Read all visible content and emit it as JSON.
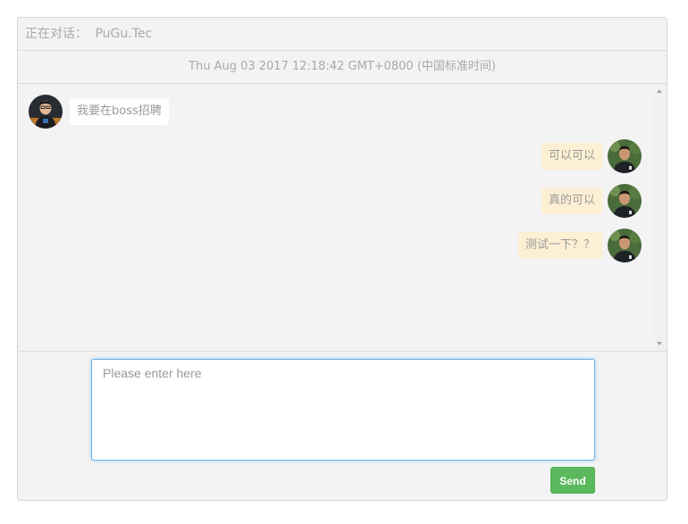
{
  "header": {
    "label": "正在对话：",
    "contact_name": "PuGu.Tec"
  },
  "timestamp": "Thu Aug 03 2017 12:18:42 GMT+0800 (中国标准时间)",
  "messages": [
    {
      "side": "left",
      "text": "我要在boss招聘",
      "avatar": "contact-avatar"
    },
    {
      "side": "right",
      "text": "可以可以",
      "avatar": "self-avatar"
    },
    {
      "side": "right",
      "text": "真的可以",
      "avatar": "self-avatar"
    },
    {
      "side": "right",
      "text": "测试一下？？",
      "avatar": "self-avatar"
    }
  ],
  "composer": {
    "placeholder": "Please enter here",
    "value": "",
    "send_label": "Send"
  },
  "colors": {
    "accent_send": "#5cb85c",
    "bubble_self": "#fcefd3",
    "bubble_other": "#ffffff",
    "input_focus": "#66afe9"
  }
}
